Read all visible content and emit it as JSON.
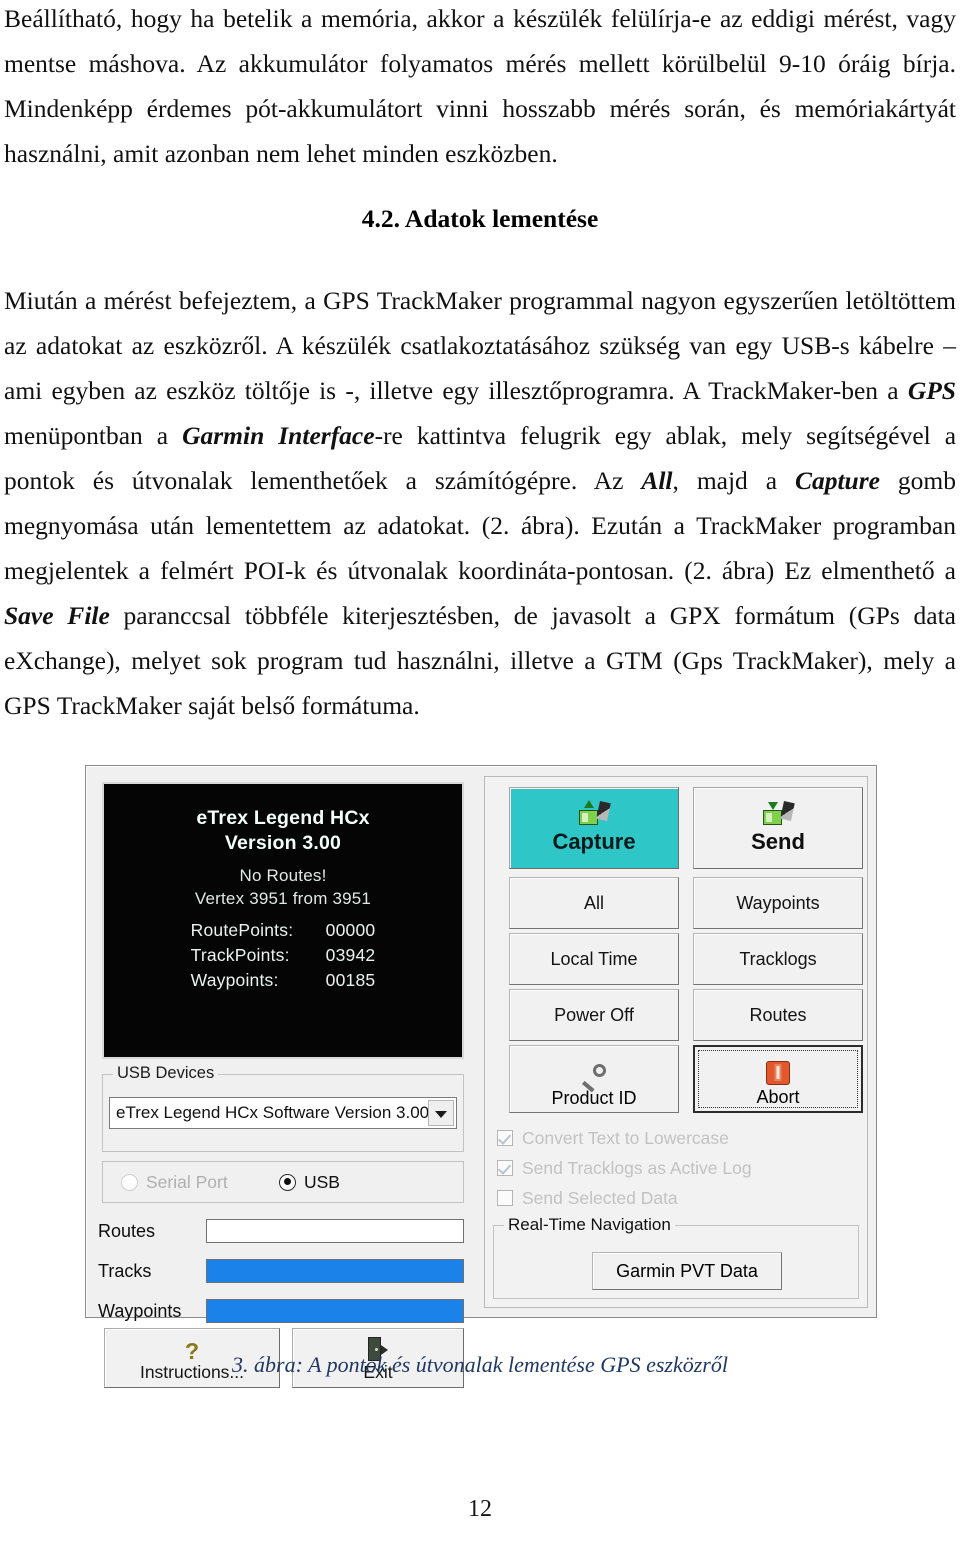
{
  "document": {
    "page_number": "12",
    "paragraph_1": "Beállítható, hogy ha betelik a memória, akkor a készülék felülírja-e az eddigi mérést, vagy mentse máshova. Az akkumulátor folyamatos mérés mellett körülbelül 9-10 óráig bírja. Mindenképp érdemes pót-akkumulátort vinni hosszabb mérés során, és memóriakártyát használni, amit azonban nem lehet minden eszközben.",
    "heading": "4.2. Adatok lementése",
    "paragraph_2_parts": {
      "p1": "Miután a mérést befejeztem, a GPS TrackMaker programmal nagyon egyszerűen letöltöttem az adatokat az eszközről. A készülék csatlakoztatásához szükség van egy USB-s kábelre – ami egyben az eszköz töltője is -, illetve egy illesztőprogramra. A TrackMaker-ben a ",
      "em1": "GPS",
      "p2": " menüpontban a ",
      "em2": "Garmin Interface",
      "p3": "-re kattintva felugrik egy ablak, mely segítségével a pontok és útvonalak lementhetőek a számítógépre. Az ",
      "em3": "All",
      "p4": ", majd a ",
      "em4": "Capture",
      "p5": " gomb megnyomása után lementettem az adatokat. (2. ábra). Ezután a TrackMaker programban megjelentek a felmért POI-k és útvonalak koordináta-pontosan. (2. ábra) Ez elmenthető a ",
      "em5": "Save File",
      "p6": " paranccsal többféle kiterjesztésben, de javasolt a GPX formátum (GPs data eXchange), melyet sok program tud használni, illetve a GTM (Gps TrackMaker), mely a GPS TrackMaker saját belső formátuma."
    },
    "figure_caption": "3. ábra: A pontok és útvonalak lementése GPS eszközről"
  },
  "dialog": {
    "device_screen": {
      "title_line1": "eTrex Legend HCx",
      "title_line2": "Version 3.00",
      "no_routes": "No Routes!",
      "vertex": "Vertex 3951 from 3951",
      "stats": [
        {
          "label": "RoutePoints:",
          "value": "00000"
        },
        {
          "label": "TrackPoints:",
          "value": "03942"
        },
        {
          "label": "Waypoints:",
          "value": "00185"
        }
      ]
    },
    "usb_devices": {
      "group_label": "USB Devices",
      "selected": "eTrex Legend HCx Software Version 3.00"
    },
    "port": {
      "serial_label": "Serial Port",
      "usb_label": "USB",
      "selected": "USB"
    },
    "progress": [
      {
        "label": "Routes",
        "percent": 0
      },
      {
        "label": "Tracks",
        "percent": 100
      },
      {
        "label": "Waypoints",
        "percent": 100
      }
    ],
    "bottom_buttons": {
      "instructions": "Instructions...",
      "exit": "Exit"
    },
    "actions": {
      "capture": "Capture",
      "send": "Send",
      "all": "All",
      "waypoints": "Waypoints",
      "local_time": "Local Time",
      "tracklogs": "Tracklogs",
      "power_off": "Power Off",
      "routes": "Routes",
      "product_id": "Product ID",
      "abort": "Abort"
    },
    "checkboxes": [
      {
        "label": "Convert Text to Lowercase",
        "checked": true
      },
      {
        "label": "Send Tracklogs as Active Log",
        "checked": true
      },
      {
        "label": "Send Selected Data",
        "checked": false
      }
    ],
    "realtime_nav": {
      "group_label": "Real-Time Navigation",
      "button": "Garmin PVT Data"
    },
    "colors": {
      "capture_accent": "#2ec6c6",
      "progress_fill": "#1b82ea",
      "abort_accent": "#e2572c",
      "caption_color": "#1f3864"
    }
  }
}
